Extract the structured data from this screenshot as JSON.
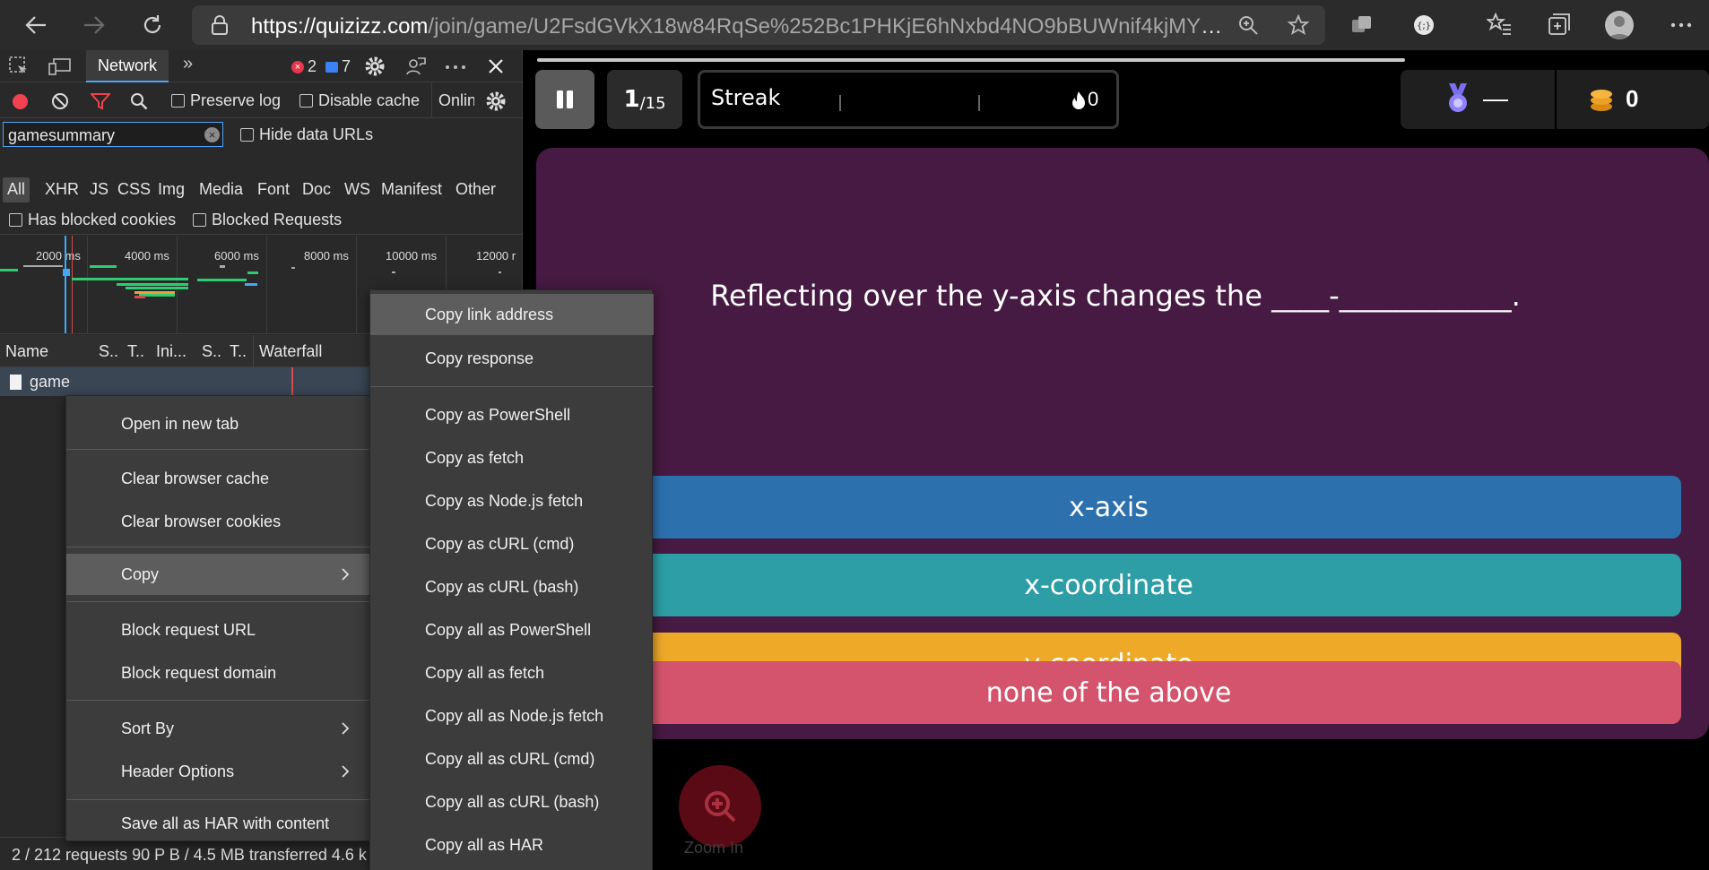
{
  "browser": {
    "url_host": "https://quizizz.com",
    "url_path": "/join/game/U2FsdGVkX18w84RqSe%252Bc1PHKjE6hNxbd4NO9bBUWnif4kjMY3..."
  },
  "devtools": {
    "tab_network": "Network",
    "errors_count": "2",
    "messages_count": "7",
    "preserve_log": "Preserve log",
    "disable_cache": "Disable cache",
    "online": "Onlin",
    "filter_value": "gamesummary",
    "hide_data_urls": "Hide data URLs",
    "type_filters": [
      "All",
      "XHR",
      "JS",
      "CSS",
      "Img",
      "Media",
      "Font",
      "Doc",
      "WS",
      "Manifest",
      "Other"
    ],
    "has_blocked_cookies": "Has blocked cookies",
    "blocked_requests": "Blocked Requests",
    "timeline_ticks": [
      "2000 ms",
      "4000 ms",
      "6000 ms",
      "8000 ms",
      "10000 ms",
      "12000 r"
    ],
    "columns": [
      "Name",
      "S..",
      "T..",
      "Ini...",
      "S..",
      "T..",
      "Waterfall"
    ],
    "row_name": "game",
    "status_bar": "2 / 212 requests   90 P B / 4.5 MB transferred   4.6 k"
  },
  "context_menu": {
    "items": [
      "Open in new tab",
      "Clear browser cache",
      "Clear browser cookies",
      "Copy",
      "Block request URL",
      "Block request domain",
      "Sort By",
      "Header Options",
      "Save all as HAR with content"
    ]
  },
  "copy_submenu": {
    "items": [
      "Copy link address",
      "Copy response",
      "Copy as PowerShell",
      "Copy as fetch",
      "Copy as Node.js fetch",
      "Copy as cURL (cmd)",
      "Copy as cURL (bash)",
      "Copy all as PowerShell",
      "Copy all as fetch",
      "Copy all as Node.js fetch",
      "Copy all as cURL (cmd)",
      "Copy all as cURL (bash)",
      "Copy all as HAR"
    ]
  },
  "quiz": {
    "progress_current": "1",
    "progress_total": "/15",
    "streak_label": "Streak",
    "streak_count": "0",
    "rank": "—",
    "coins": "0",
    "question": "Reflecting over the y-axis changes the ____-____________.",
    "answers": [
      "x-axis",
      "x-coordinate",
      "y-coordinate",
      "none of the above"
    ],
    "zoom_label": "Zoom In",
    "colors": {
      "question_bg": "#461a42",
      "answer_1": "#2d70ae",
      "answer_2": "#2d9da6",
      "answer_3": "#efa929",
      "answer_4": "#d5546d"
    }
  }
}
